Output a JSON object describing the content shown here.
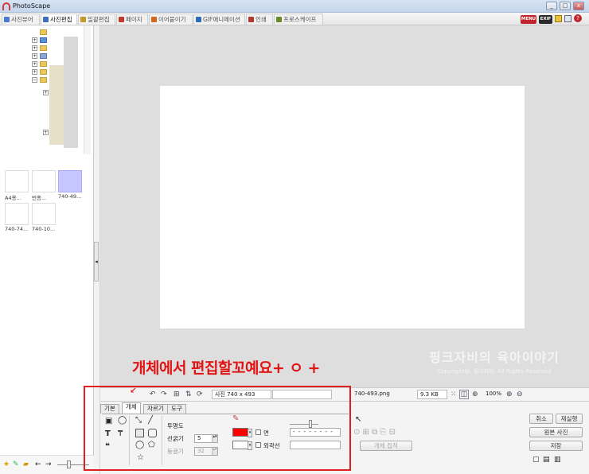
{
  "window": {
    "title": "PhotoScape",
    "minimize": "_",
    "maximize": "□",
    "close": "x"
  },
  "menu": {
    "tabs": [
      {
        "label": "사진뷰어",
        "icon": "viewer-icon",
        "color": "#4a7bd0"
      },
      {
        "label": "사진편집",
        "icon": "editor-icon",
        "color": "#3d6fb8"
      },
      {
        "label": "일괄편집",
        "icon": "batch-icon",
        "color": "#c29a2a"
      },
      {
        "label": "페이지",
        "icon": "page-icon",
        "color": "#c0392b"
      },
      {
        "label": "이어붙이기",
        "icon": "combine-icon",
        "color": "#d2691e"
      },
      {
        "label": "GIF애니메이션",
        "icon": "gif-icon",
        "color": "#2e6db4"
      },
      {
        "label": "인쇄",
        "icon": "print-icon",
        "color": "#b03a2e"
      },
      {
        "label": "프로스케이프",
        "icon": "photoscape-icon",
        "color": "#6a8a2a"
      }
    ],
    "right_icons": [
      {
        "label": "MENU",
        "color": "#c0262d"
      },
      {
        "label": "EXIF",
        "color": "#2a2a2a"
      }
    ]
  },
  "thumbnails": [
    {
      "caption": "A4용..."
    },
    {
      "caption": "빈종..."
    },
    {
      "caption": "740-49...",
      "selected": true
    },
    {
      "caption": "740-74..."
    },
    {
      "caption": "740-10..."
    }
  ],
  "overlay": {
    "red_text": "개체에서 편집할꼬예요+ ㅇ +",
    "watermark_title": "핑크자비의 육아이야기",
    "watermark_copy": "Copyright@. 핑크자비. All Rights Reserved"
  },
  "status": {
    "photo_size": "사진 740 x 493",
    "filename": "740-493.png",
    "filesize": "9.3 KB",
    "zoom": "100%"
  },
  "editor_tabs": [
    "기본",
    "개체",
    "자르기",
    "도구"
  ],
  "object_panel": {
    "opacity_label": "투명도",
    "line_width_label": "선굵기",
    "line_width_value": "5",
    "rounding_label": "둥글기",
    "rounding_value": "32",
    "fill_label": "면",
    "outline_label": "외곽선",
    "dash_pattern": "- - - - - - - -",
    "current_color": "#ff0000",
    "object_merge_button": "개체 접착"
  },
  "right_buttons": {
    "cancel": "취소",
    "redo": "재실행",
    "original": "원본 사진",
    "save": "저장"
  }
}
